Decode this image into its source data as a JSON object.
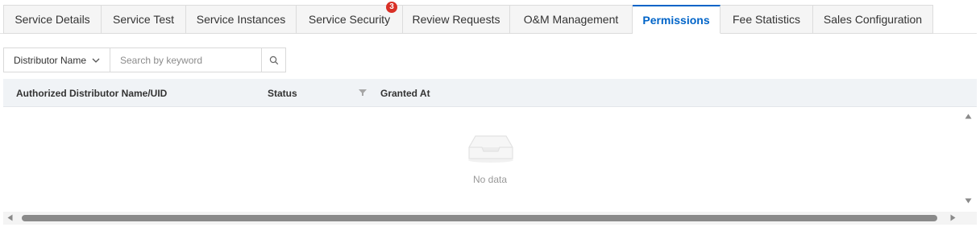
{
  "tabs": [
    {
      "label": "Service Details",
      "active": false
    },
    {
      "label": "Service Test",
      "active": false
    },
    {
      "label": "Service Instances",
      "active": false
    },
    {
      "label": "Service Security",
      "active": false,
      "badge": "3"
    },
    {
      "label": "Review Requests",
      "active": false
    },
    {
      "label": "O&M Management",
      "active": false
    },
    {
      "label": "Permissions",
      "active": true
    },
    {
      "label": "Fee Statistics",
      "active": false
    },
    {
      "label": "Sales Configuration",
      "active": false
    }
  ],
  "search": {
    "filter_label": "Distributor Name",
    "placeholder": "Search by keyword",
    "filter_icon": "chevron-down-icon",
    "search_icon": "search-icon"
  },
  "table": {
    "columns": [
      "Authorized Distributor Name/UID",
      "Status",
      "Granted At"
    ],
    "empty_text": "No data",
    "empty_icon": "inbox-icon"
  },
  "colors": {
    "accent": "#0064c8",
    "badge": "#d93026",
    "header_bg": "#f0f3f6"
  }
}
